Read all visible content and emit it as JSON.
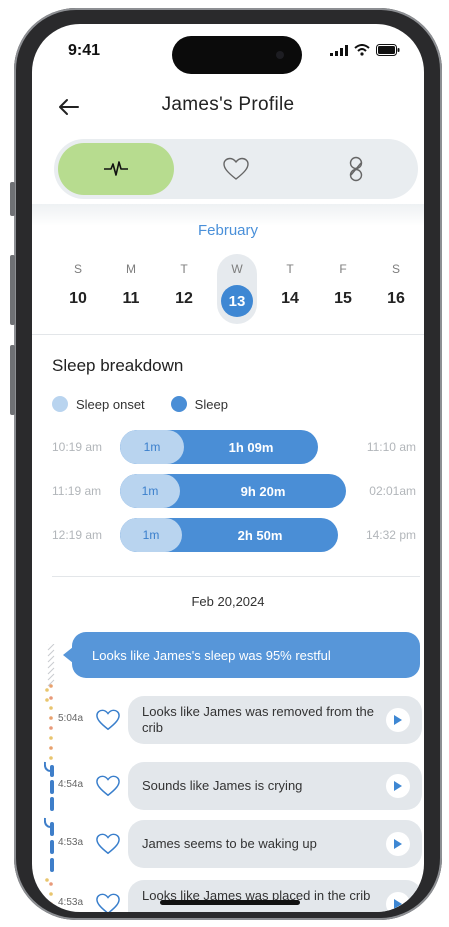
{
  "status": {
    "time": "9:41"
  },
  "header": {
    "title": "James's  Profile"
  },
  "tabs": [
    {
      "icon": "heartbeat-icon",
      "active": true
    },
    {
      "icon": "heart-icon",
      "active": false
    },
    {
      "icon": "pacifier-icon",
      "active": false
    }
  ],
  "calendar": {
    "month": "February",
    "days": [
      {
        "letter": "S",
        "num": "10"
      },
      {
        "letter": "M",
        "num": "11"
      },
      {
        "letter": "T",
        "num": "12"
      },
      {
        "letter": "W",
        "num": "13"
      },
      {
        "letter": "T",
        "num": "14"
      },
      {
        "letter": "F",
        "num": "15"
      },
      {
        "letter": "S",
        "num": "16"
      }
    ],
    "selected_index": 3
  },
  "sleep": {
    "title": "Sleep breakdown",
    "legend": {
      "onset": "Sleep onset",
      "sleep": "Sleep"
    },
    "colors": {
      "onset": "#b9d4ef",
      "sleep": "#4a8ed6"
    },
    "rows": [
      {
        "start": "10:19 am",
        "onset": "1m",
        "duration": "1h 09m",
        "end": "11:10 am"
      },
      {
        "start": "11:19 am",
        "onset": "1m",
        "duration": "9h 20m",
        "end": "02:01am"
      },
      {
        "start": "12:19 am",
        "onset": "1m",
        "duration": "2h 50m",
        "end": "14:32 pm"
      }
    ]
  },
  "log": {
    "date": "Feb 20,2024",
    "summary": "Looks like James's sleep was 95% restful",
    "events": [
      {
        "time": "5:04a",
        "text": "Looks like James was removed from the crib"
      },
      {
        "time": "4:54a",
        "text": "Sounds like James is crying"
      },
      {
        "time": "4:53a",
        "text": "James seems to be waking up"
      },
      {
        "time": "4:53a",
        "text": "Looks like James was placed in the crib"
      }
    ]
  }
}
